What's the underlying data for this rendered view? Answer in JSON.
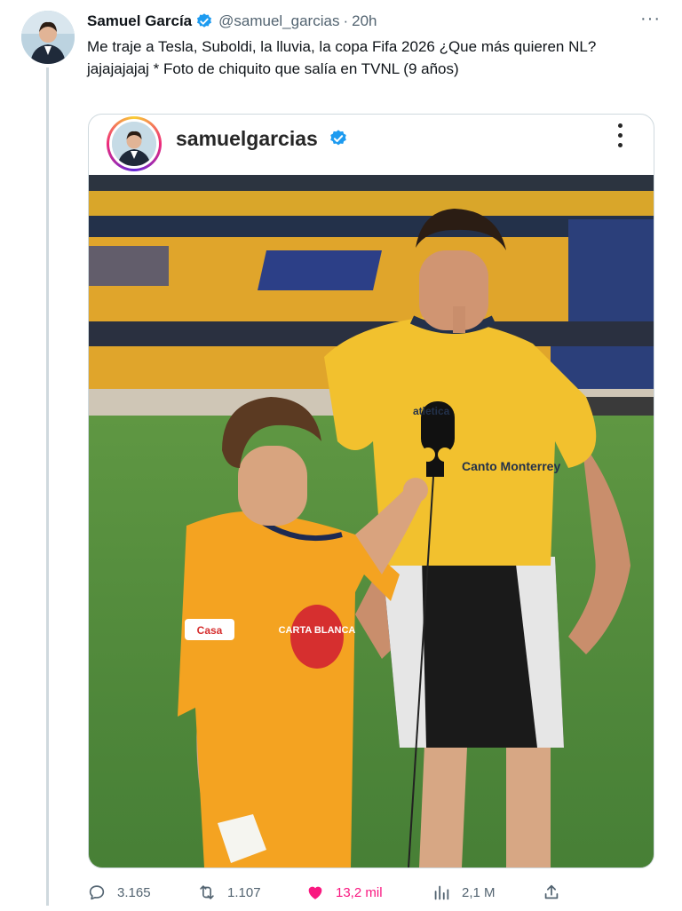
{
  "tweet": {
    "author_name": "Samuel García",
    "handle": "@samuel_garcias",
    "separator": "·",
    "time": "20h",
    "more_label": "···",
    "text_line1": "Me traje a Tesla, Suboldi, la lluvia, la copa Fifa 2026 ¿Que más quieren NL?",
    "text_line2": "jajajajajaj * Foto de chiquito que salía en TVNL (9 años)"
  },
  "embed": {
    "username": "samuelgarcias",
    "verified": true
  },
  "photo_text": {
    "boy_sponsor": "CARTA BLANCA",
    "boy_badge": "Casa",
    "shirt_text": "atletica",
    "shirt_sponsor": "Canto Monterrey"
  },
  "stats": {
    "replies": "3.165",
    "retweets": "1.107",
    "likes": "13,2 mil",
    "views": "2,1 M"
  },
  "colors": {
    "accent": "#1d9bf0",
    "like": "#f91880",
    "muted": "#536471",
    "border": "#cfd9de"
  },
  "icons": [
    "verified-icon",
    "more-icon",
    "reply-icon",
    "retweet-icon",
    "heart-icon",
    "views-icon",
    "share-icon"
  ]
}
